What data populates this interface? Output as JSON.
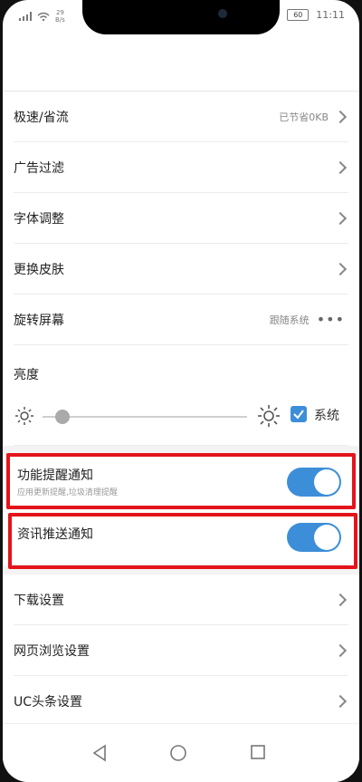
{
  "status": {
    "speed": "29",
    "speed_unit": "B/s",
    "battery": "60",
    "time": "11:11"
  },
  "settings": {
    "rows": [
      {
        "label": "极速/省流",
        "value": "已节省0KB"
      },
      {
        "label": "广告过滤"
      },
      {
        "label": "字体调整"
      },
      {
        "label": "更换皮肤"
      },
      {
        "label": "旋转屏幕",
        "value": "跟随系统"
      }
    ],
    "brightness": {
      "label": "亮度",
      "level": 0.1,
      "system_checked": true,
      "system_label": "系统"
    },
    "toggles": [
      {
        "label": "功能提醒通知",
        "sub": "应用更新提醒,垃圾清理提醒",
        "on": true
      },
      {
        "label": "资讯推送通知",
        "on": true
      }
    ],
    "more_rows": [
      {
        "label": "下载设置"
      },
      {
        "label": "网页浏览设置"
      },
      {
        "label": "UC头条设置"
      }
    ]
  },
  "colors": {
    "accent": "#3d8ed8",
    "highlight": "#e4141b"
  }
}
